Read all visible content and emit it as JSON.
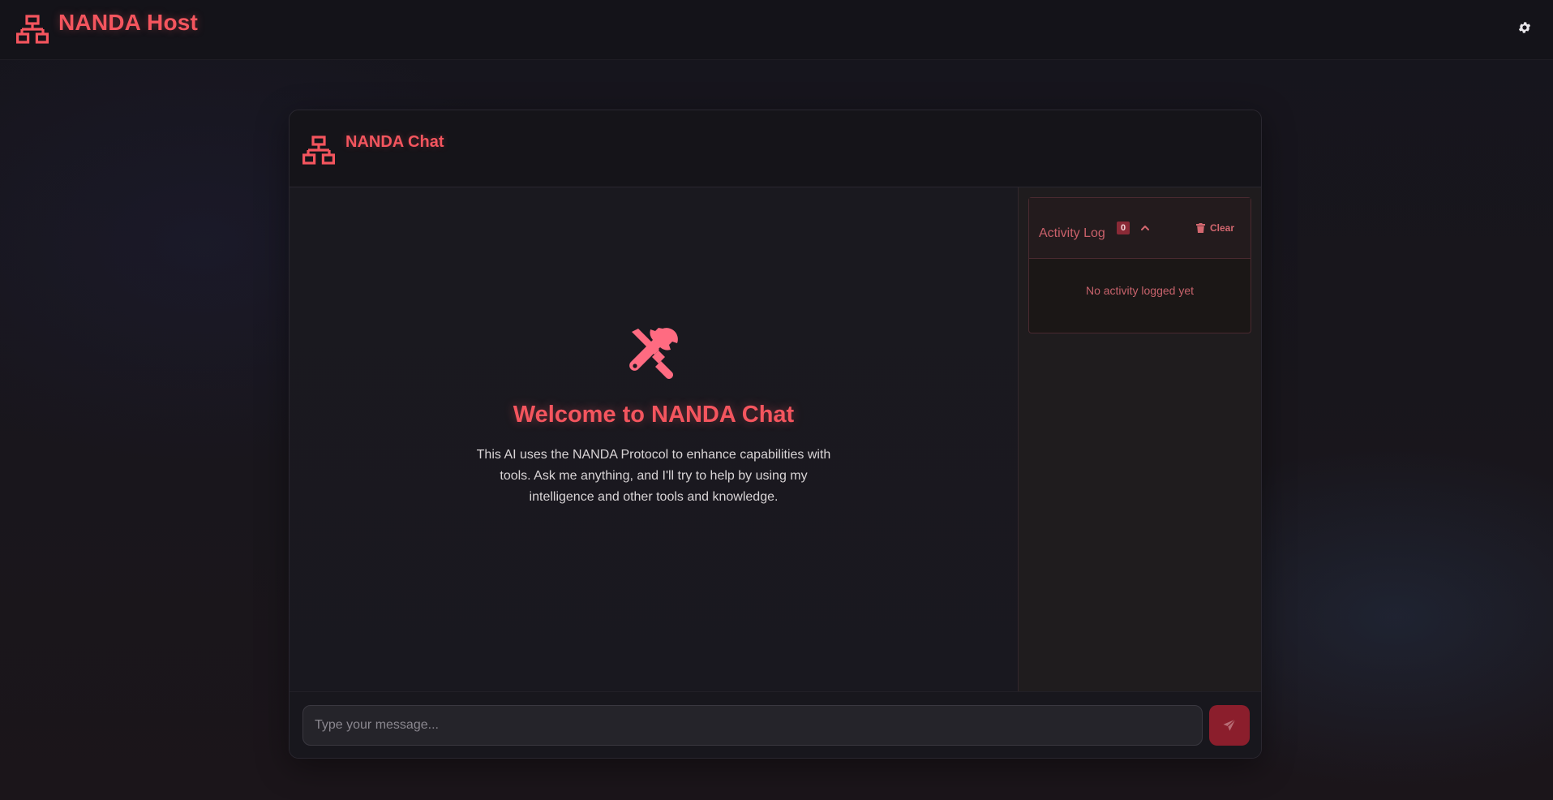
{
  "app": {
    "title": "NANDA Host",
    "icons": {
      "brand": "network-icon",
      "settings": "gear-icon"
    }
  },
  "chat": {
    "title": "NANDA Chat",
    "welcome": {
      "icon": "tools-icon",
      "title": "Welcome to NANDA Chat",
      "text": "This AI uses the NANDA Protocol to enhance capabilities with tools. Ask me anything, and I'll try to help by using my intelligence and other tools and knowledge."
    },
    "input": {
      "placeholder": "Type your message...",
      "value": ""
    },
    "send_icon": "paper-plane-icon"
  },
  "activity_log": {
    "title": "Activity Log",
    "count": "0",
    "clear_label": "Clear",
    "empty_text": "No activity logged yet"
  },
  "colors": {
    "accent": "#f4555e",
    "send_button": "#8b1e2c",
    "badge": "#8a2a36",
    "background": "#18171d"
  }
}
